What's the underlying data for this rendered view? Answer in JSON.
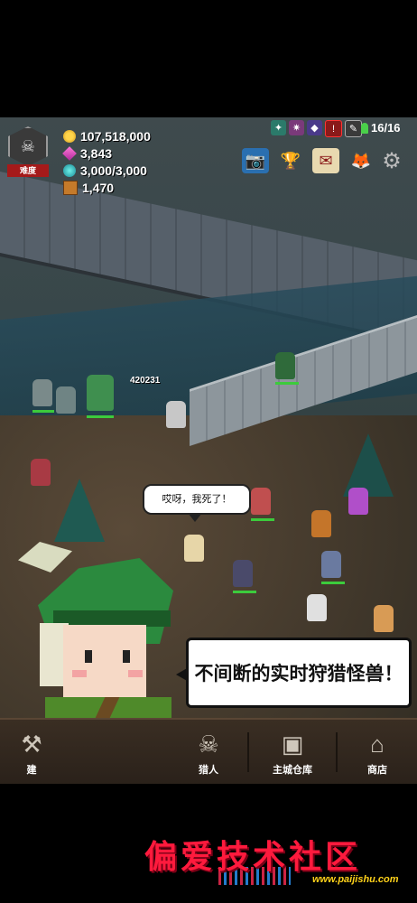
{
  "difficulty": {
    "label": "难度"
  },
  "resources": [
    {
      "icon": "gold-coin-icon",
      "value": "107,518,000"
    },
    {
      "icon": "pink-gem-icon",
      "value": "3,843"
    },
    {
      "icon": "crystal-icon",
      "value": "3,000/3,000"
    },
    {
      "icon": "chest-icon",
      "value": "1,470"
    }
  ],
  "hunter_count": "16/16",
  "damage_number": "420231",
  "speech_bubble": "哎呀，我死了！",
  "promo_text": "不间断的实时狩猎怪兽！",
  "bottom_nav": {
    "build": "建",
    "hunters": "猎人",
    "warehouse": "主城仓库",
    "shop": "商店"
  },
  "watermark": {
    "title": "偏爱技术社区",
    "url": "www.paijishu.com"
  },
  "colors": {
    "accent_red": "#a51a1a",
    "hp_green": "#3ccb3c",
    "watermark_red": "#ff1a3d"
  }
}
